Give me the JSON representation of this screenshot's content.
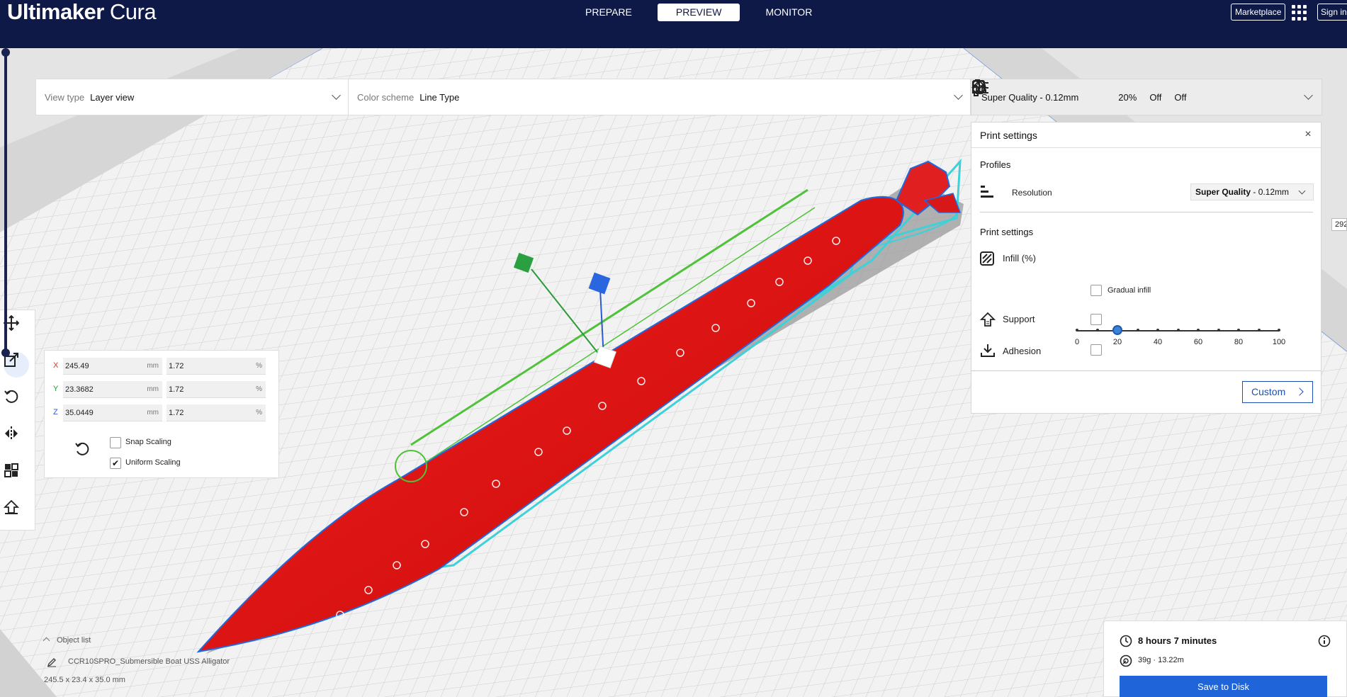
{
  "app": {
    "name_bold": "Ultimaker",
    "name_light": "Cura"
  },
  "header": {
    "stages": [
      {
        "label": "PREPARE",
        "active": false
      },
      {
        "label": "PREVIEW",
        "active": true
      },
      {
        "label": "MONITOR",
        "active": false
      }
    ],
    "marketplace_label": "Marketplace",
    "signin_label": "Sign in"
  },
  "viewbar": {
    "view_type_label": "View type",
    "view_type_value": "Layer view",
    "color_scheme_label": "Color scheme",
    "color_scheme_value": "Line Type"
  },
  "print_summary": {
    "profile": "Super Quality - 0.12mm",
    "infill": "20%",
    "support": "Off",
    "adhesion": "Off"
  },
  "print_settings": {
    "title": "Print settings",
    "profiles_heading": "Profiles",
    "resolution_label": "Resolution",
    "resolution_value": "Super Quality",
    "resolution_suffix": " - 0.12mm",
    "settings_heading": "Print settings",
    "infill_label": "Infill (%)",
    "infill_value": 20,
    "infill_ticks": [
      "0",
      "20",
      "40",
      "60",
      "80",
      "100"
    ],
    "gradual_infill_label": "Gradual infill",
    "gradual_infill_checked": false,
    "support_label": "Support",
    "support_checked": false,
    "adhesion_label": "Adhesion",
    "adhesion_checked": false,
    "custom_label": "Custom"
  },
  "scale_tool": {
    "rows": [
      {
        "axis": "X",
        "mm": "245.49",
        "pct": "1.72",
        "color": "#d43a2a"
      },
      {
        "axis": "Y",
        "mm": "23.3682",
        "pct": "1.72",
        "color": "#2a9a3a"
      },
      {
        "axis": "Z",
        "mm": "35.0449",
        "pct": "1.72",
        "color": "#2a5ad4"
      }
    ],
    "mm_unit": "mm",
    "pct_unit": "%",
    "snap_scaling_label": "Snap Scaling",
    "snap_scaling_checked": false,
    "uniform_scaling_label": "Uniform Scaling",
    "uniform_scaling_checked": true
  },
  "object_list": {
    "label": "Object list",
    "object_name": "CCR10SPRO_Submersible Boat USS Alligator",
    "dimensions": "245.5 x 23.4 x 35.0 mm"
  },
  "job": {
    "time": "8 hours 7 minutes",
    "material": "39g · 13.22m",
    "save_label": "Save to Disk"
  },
  "layer": {
    "current": "292"
  },
  "colors": {
    "header_bg": "#0e1948",
    "accent": "#1f64d8",
    "model_red": "#e01010",
    "travel_cyan": "#3fd0d8",
    "infill_green": "#4fc23a"
  }
}
